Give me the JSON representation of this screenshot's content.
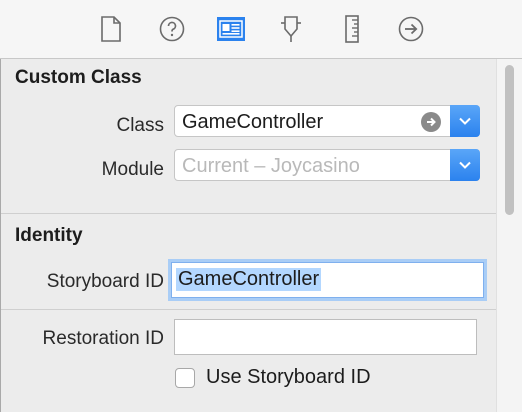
{
  "toolbar": {
    "icons": [
      {
        "name": "file-inspector-icon"
      },
      {
        "name": "quick-help-icon"
      },
      {
        "name": "identity-inspector-icon",
        "active": true
      },
      {
        "name": "attributes-inspector-icon"
      },
      {
        "name": "size-inspector-icon"
      },
      {
        "name": "connections-inspector-icon"
      }
    ],
    "accent_color": "#2b82ee"
  },
  "custom_class": {
    "title": "Custom Class",
    "class_label": "Class",
    "class_value": "GameController",
    "module_label": "Module",
    "module_placeholder": "Current – Joycasino"
  },
  "identity": {
    "title": "Identity",
    "storyboard_id_label": "Storyboard ID",
    "storyboard_id_value": "GameController",
    "restoration_id_label": "Restoration ID",
    "restoration_id_value": "",
    "use_storyboard_id_label": "Use Storyboard ID",
    "use_storyboard_id_checked": false
  }
}
